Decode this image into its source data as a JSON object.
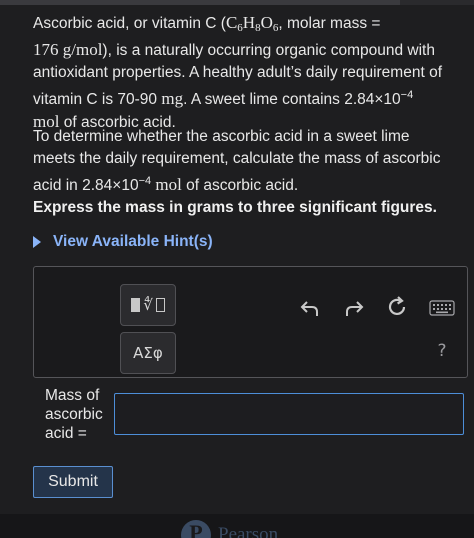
{
  "problem": {
    "p1_a": "Ascorbic acid, or vitamin C (",
    "p1_formula_c": "C",
    "p1_formula_c_sub": "6",
    "p1_formula_h": "H",
    "p1_formula_h_sub": "8",
    "p1_formula_o": "O",
    "p1_formula_o_sub": "6",
    "p1_b": ", molar mass =",
    "p1_molar_mass": "176 g/mol",
    "p1_c": "), is a naturally occurring organic compound with antioxidant properties. A healthy adult’s daily requirement of vitamin C is 70-90 ",
    "p1_unit_mg": "mg",
    "p1_d": ". A sweet lime contains 2.84×10",
    "p1_exp": "−4",
    "p1_unit_mol": " mol",
    "p1_e": " of ascorbic acid.",
    "p2_a": "To determine whether the ascorbic acid in a sweet lime meets the daily requirement, calculate the mass of ascorbic acid in 2.84×10",
    "p2_exp": "−4",
    "p2_unit_mol": " mol",
    "p2_b": " of ascorbic acid.",
    "instruction": "Express the mass in grams to three significant figures."
  },
  "hint": {
    "label": "View Available Hint(s)"
  },
  "toolbar": {
    "templates_icon": "templates-icon",
    "greek_label": "ΑΣφ",
    "undo_icon": "undo-icon",
    "redo_icon": "redo-icon",
    "reset_icon": "reset-icon",
    "keyboard_icon": "keyboard-icon",
    "help_label": "?"
  },
  "answer": {
    "label": "Mass of ascorbic acid =",
    "value": ""
  },
  "submit": {
    "label": "Submit"
  },
  "footer": {
    "brand": "Pearson"
  },
  "colors": {
    "background": "#1e1e20",
    "link": "#8ab4f8",
    "input_border": "#4d8ed8",
    "submit_bg": "#24344a"
  }
}
